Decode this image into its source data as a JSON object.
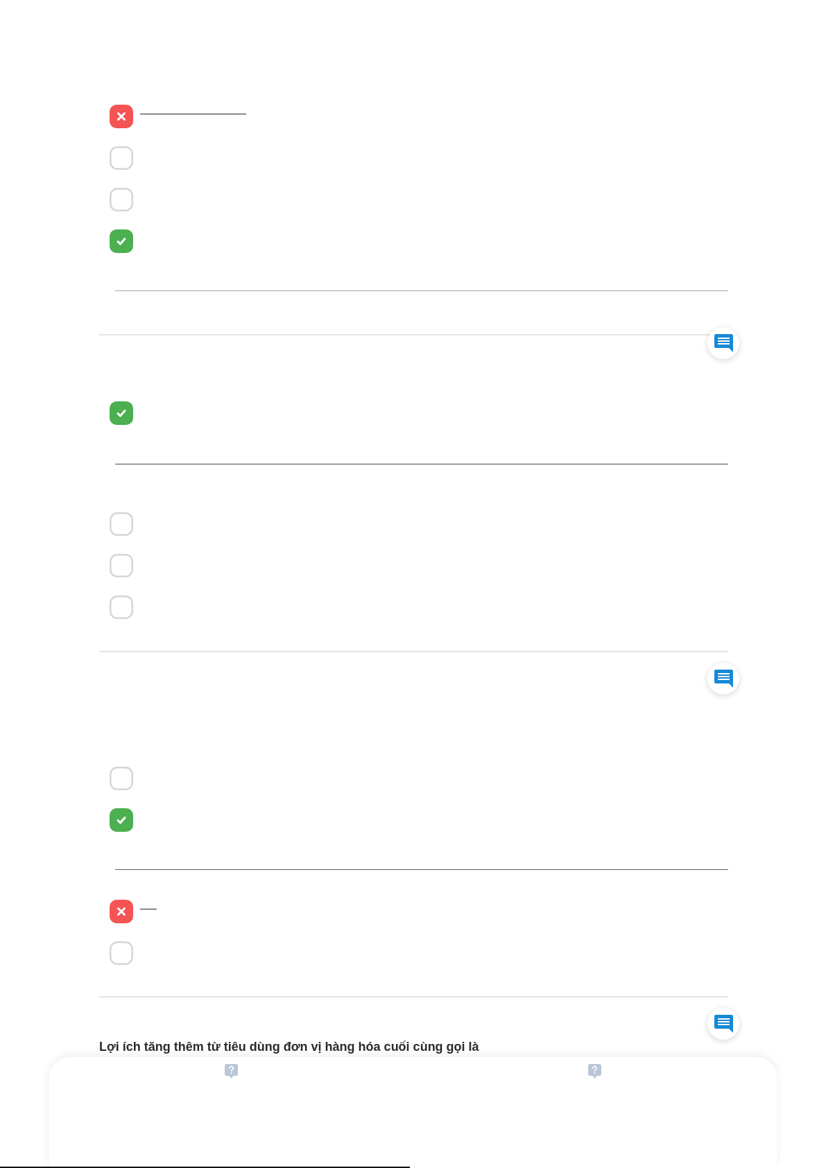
{
  "sections": [
    {
      "comment_button": false,
      "items": [
        {
          "kind": "option",
          "wrong": true,
          "correct": false,
          "underlined": true
        },
        {
          "kind": "option",
          "wrong": false,
          "correct": false,
          "underlined": false
        },
        {
          "kind": "option",
          "wrong": false,
          "correct": false,
          "underlined": false
        },
        {
          "kind": "option",
          "wrong": false,
          "correct": true,
          "underlined": false
        },
        {
          "kind": "rule"
        }
      ]
    },
    {
      "comment_button": true,
      "items": [
        {
          "kind": "option",
          "wrong": false,
          "correct": true,
          "underlined": false
        },
        {
          "kind": "rule"
        },
        {
          "kind": "option",
          "wrong": false,
          "correct": false,
          "underlined": false
        },
        {
          "kind": "option",
          "wrong": false,
          "correct": false,
          "underlined": false
        },
        {
          "kind": "option",
          "wrong": false,
          "correct": false,
          "underlined": false
        }
      ]
    },
    {
      "comment_button": true,
      "items": [
        {
          "kind": "option",
          "wrong": false,
          "correct": false,
          "underlined": false
        },
        {
          "kind": "option",
          "wrong": false,
          "correct": true,
          "underlined": false
        },
        {
          "kind": "rule"
        },
        {
          "kind": "option",
          "wrong": true,
          "correct": false,
          "underlined": true
        },
        {
          "kind": "option",
          "wrong": false,
          "correct": false,
          "underlined": false
        }
      ]
    },
    {
      "comment_button": true,
      "question": "Lợi ích tăng thêm từ tiêu dùng đơn vị hàng hóa cuối cùng gọi là"
    }
  ],
  "bottom_panel": {
    "buttons": [
      {
        "kind": "help"
      },
      {
        "kind": "help"
      }
    ]
  },
  "progress": {
    "level": 0.496
  }
}
